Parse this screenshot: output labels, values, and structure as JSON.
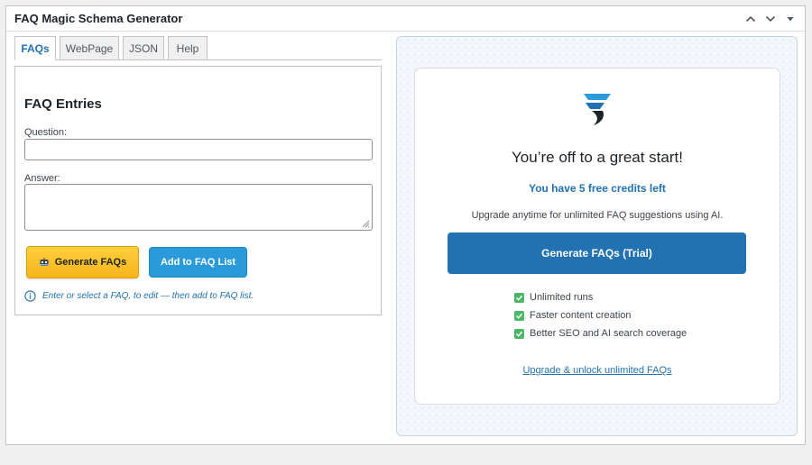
{
  "metabox": {
    "title": "FAQ Magic Schema Generator"
  },
  "tabs": [
    {
      "label": "FAQs"
    },
    {
      "label": "WebPage"
    },
    {
      "label": "JSON"
    },
    {
      "label": "Help"
    }
  ],
  "form": {
    "heading": "FAQ Entries",
    "question_label": "Question:",
    "question_value": "",
    "answer_label": "Answer:",
    "answer_value": "",
    "generate_label": "Generate FAQs",
    "add_label": "Add to FAQ List",
    "hint": "Enter or select a FAQ, to edit — then add to FAQ list."
  },
  "promo": {
    "heading": "You’re off to a great start!",
    "credits": "You have 5 free credits left",
    "subtext": "Upgrade anytime for unlimited FAQ suggestions using AI.",
    "trial_button": "Generate FAQs (Trial)",
    "features": [
      "Unlimited runs",
      "Faster content creation",
      "Better SEO and AI search coverage"
    ],
    "upgrade_link": "Upgrade & unlock unlimited FAQs"
  },
  "colors": {
    "accent": "#2271b1",
    "generate_button": "#f8b41b",
    "add_button": "#2a9adb",
    "check": "#4ab866"
  },
  "icons": {
    "collapse_up": "chevron-up-icon",
    "collapse_down": "chevron-down-icon",
    "toggle": "caret-down-icon",
    "generate": "robot-icon",
    "hint": "info-icon",
    "logo": "brand-logo-icon",
    "check": "check-icon"
  }
}
